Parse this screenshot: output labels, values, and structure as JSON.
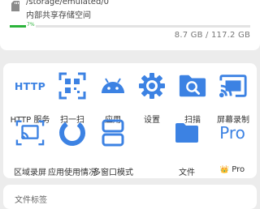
{
  "storage": {
    "path": "/storage/emulated/0",
    "description": "内部共享存储空间",
    "used_percent": 7,
    "percent_label": "7%",
    "size_text": "8.7 GB  /  117.2 GB",
    "bar_color": "#2bb33a"
  },
  "tools": {
    "accent_color": "#3c82e3",
    "items": [
      {
        "label": "HTTP 服务",
        "icon": "http-icon",
        "icon_text": "HTTP"
      },
      {
        "label": "扫一扫",
        "icon": "qr-scan-icon"
      },
      {
        "label": "应用",
        "icon": "android-icon"
      },
      {
        "label": "设置",
        "icon": "gear-icon"
      },
      {
        "label": "扫描",
        "icon": "folder-search-icon"
      },
      {
        "label": "屏幕录制",
        "icon": "screen-cast-icon"
      },
      {
        "label": "区域录屏",
        "icon": "area-record-icon"
      },
      {
        "label": "应用使用情况",
        "icon": "usage-ring-icon"
      },
      {
        "label": "多窗口模式",
        "icon": "multi-window-icon"
      },
      {
        "label": "文件",
        "icon": "folder-icon"
      },
      {
        "label": "Pro",
        "icon": "pro-icon",
        "icon_text": "Pro",
        "crown": "👑"
      }
    ]
  },
  "bottom_section": {
    "title": "文件标签"
  }
}
